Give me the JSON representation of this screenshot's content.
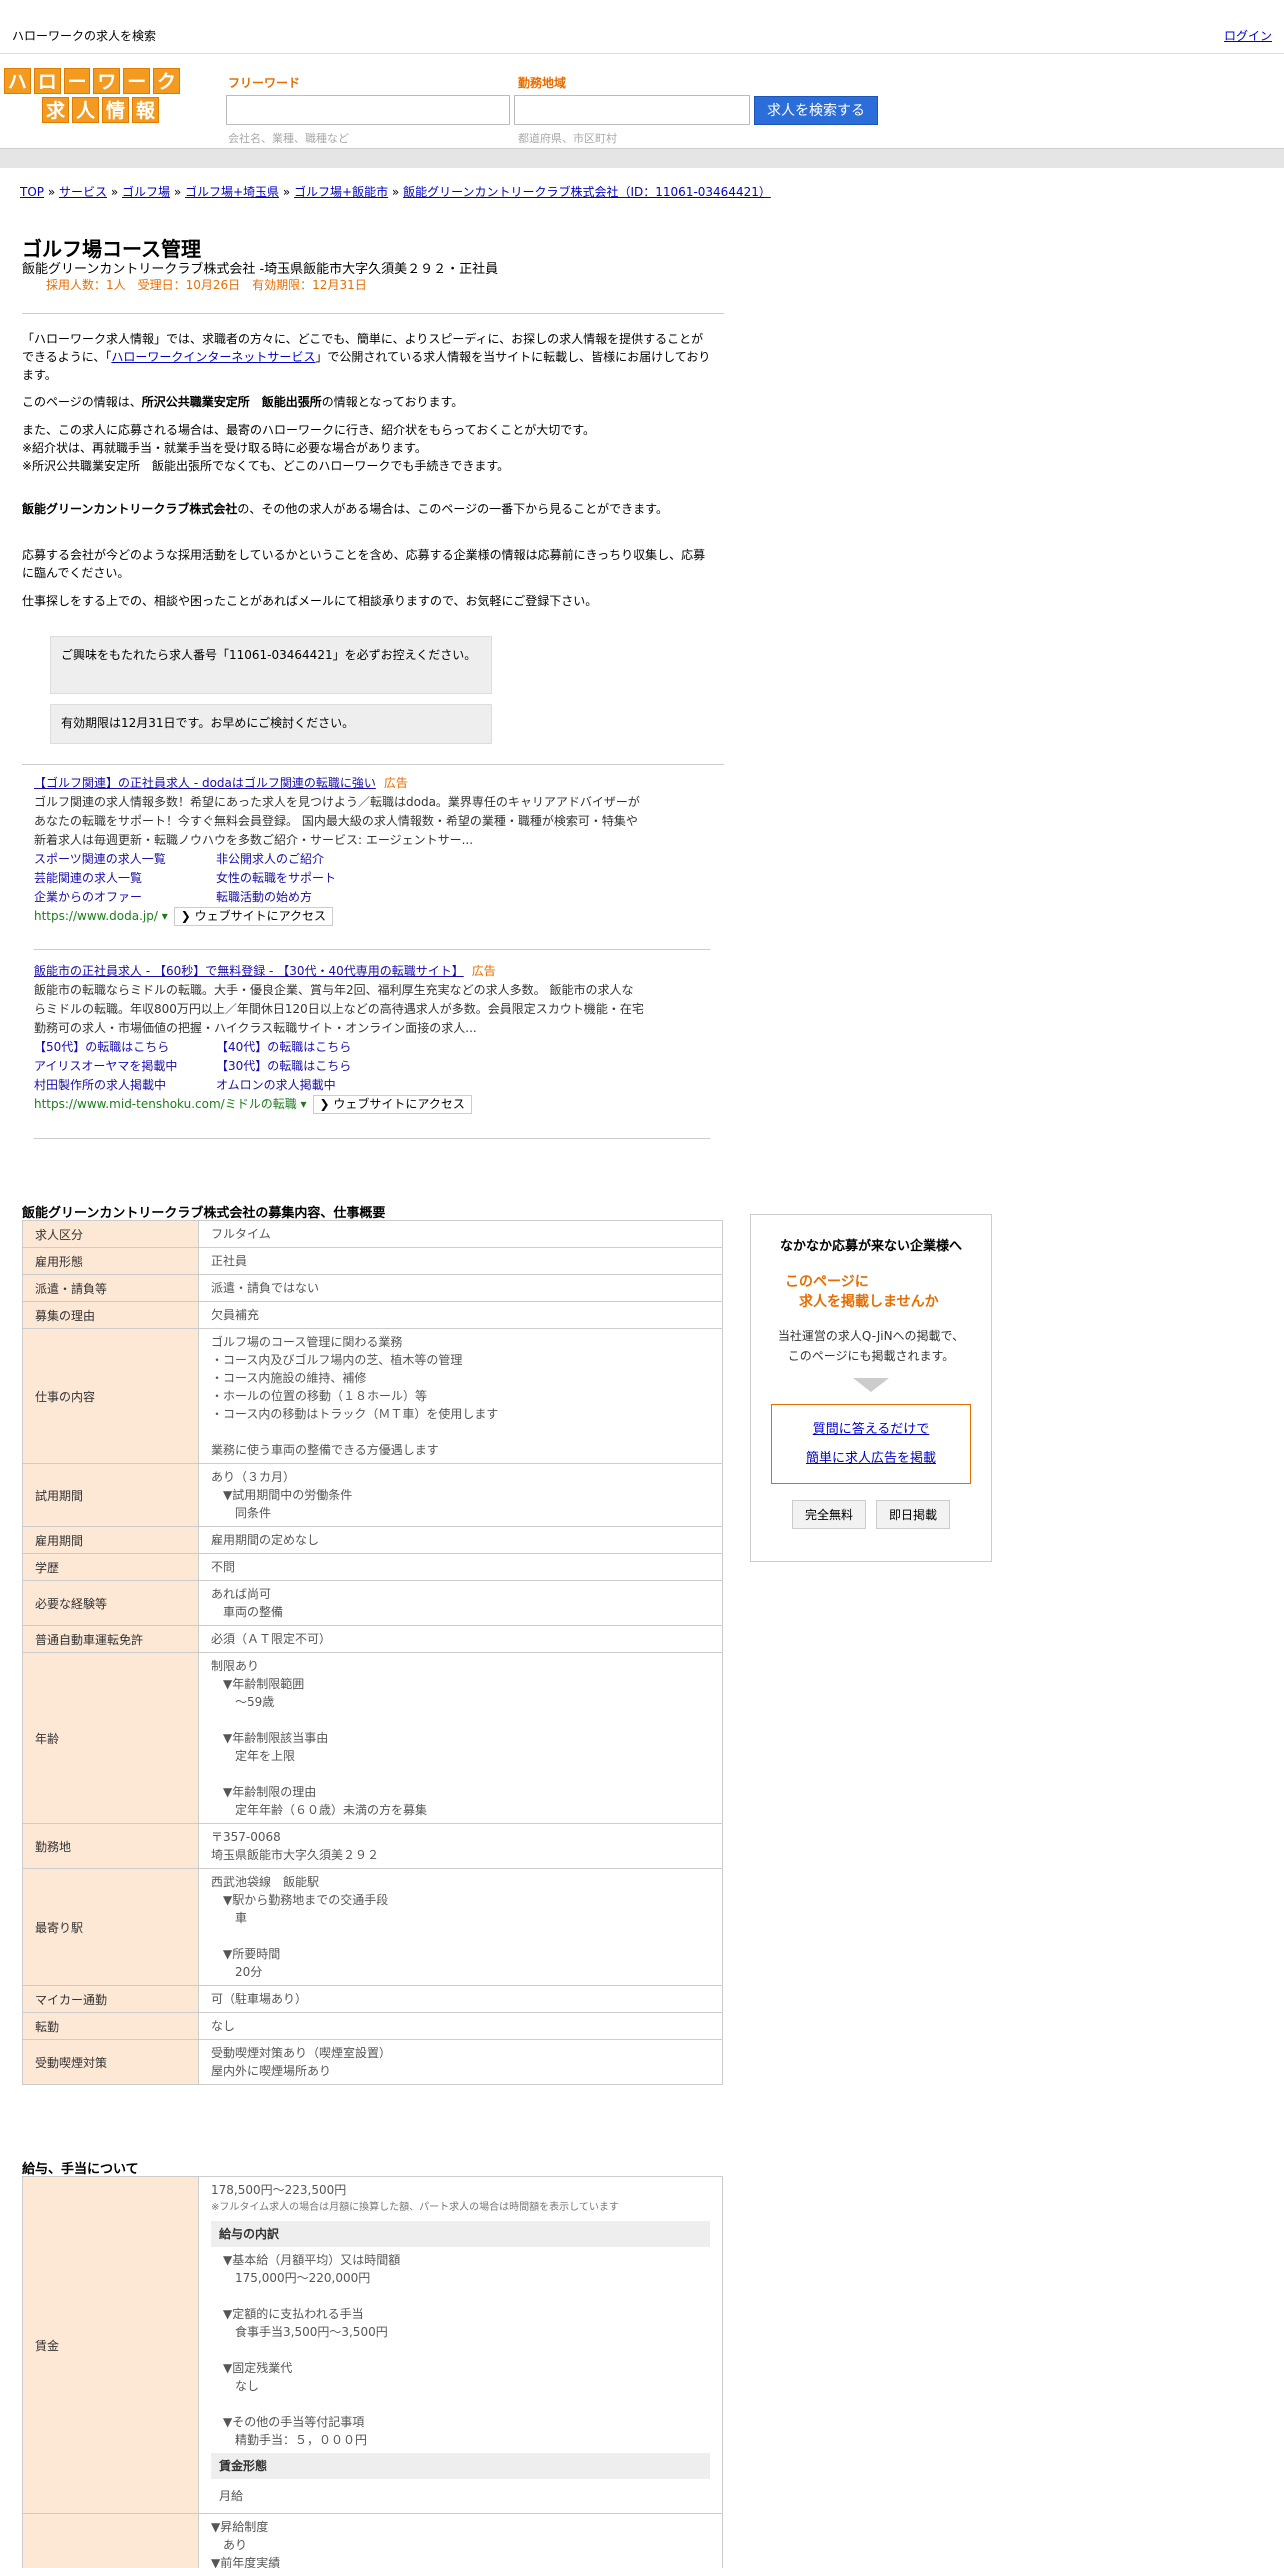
{
  "topbar": {
    "title": "ハローワークの求人を検索",
    "login": "ログイン"
  },
  "logo": {
    "row1": [
      "ハ",
      "ロ",
      "ー",
      "ワ",
      "ー",
      "ク"
    ],
    "row2": [
      "求",
      "人",
      "情",
      "報"
    ]
  },
  "search": {
    "free_label": "フリーワード",
    "free_placeholder": "会社名、業種、職種など",
    "area_label": "勤務地域",
    "area_placeholder": "都道府県、市区町村",
    "button": "求人を検索する"
  },
  "breadcrumb": [
    "TOP",
    "サービス",
    "ゴルフ場",
    "ゴルフ場+埼玉県",
    "ゴルフ場+飯能市",
    "飯能グリーンカントリークラブ株式会社（ID：11061-03464421）"
  ],
  "job": {
    "title": "ゴルフ場コース管理",
    "subtitle": "飯能グリーンカントリークラブ株式会社 -埼玉県飯能市大字久須美２９２・正社員",
    "meta": "採用人数：1人　受理日：10月26日　有効期限：12月31日"
  },
  "intro": {
    "p1a": "「ハローワーク求人情報」では、求職者の方々に、どこでも、簡単に、よりスピーディに、お探しの求人情報を提供することができるように、「",
    "p1link": "ハローワークインターネットサービス",
    "p1b": "」で公開されている求人情報を当サイトに転載し、皆様にお届けしております。",
    "p2a": "このページの情報は、",
    "p2b": "所沢公共職業安定所　飯能出張所",
    "p2c": "の情報となっております。",
    "p3": [
      "また、この求人に応募される場合は、最寄のハローワークに行き、紹介状をもらっておくことが大切です。",
      "※紹介状は、再就職手当・就業手当を受け取る時に必要な場合があります。",
      "※所沢公共職業安定所　飯能出張所でなくても、どこのハローワークでも手続きできます。"
    ],
    "p4a": "飯能グリーンカントリークラブ株式会社",
    "p4b": "の、その他の求人がある場合は、このページの一番下から見ることができます。",
    "p5": "応募する会社が今どのような採用活動をしているかということを含め、応募する企業様の情報は応募前にきっちり収集し、応募に臨んでください。",
    "p6": "仕事探しをする上での、相談や困ったことがあればメールにて相談承りますので、お気軽にご登録下さい。"
  },
  "notices": [
    "ご興味をもたれたら求人番号「11061-03464421」を必ずお控えください。",
    "有効期限は12月31日です。お早めにご検討ください。"
  ],
  "ads": [
    {
      "title": "【ゴルフ関連】の正社員求人 - dodaはゴルフ関連の転職に強い",
      "tag": "広告",
      "desc": "ゴルフ関連の求人情報多数！希望にあった求人を見つけよう／転職はdoda。業界専任のキャリアアドバイザーがあなたの転職をサポート！今すぐ無料会員登録。 国内最大級の求人情報数・希望の業種・職種が検索可・特集や新着求人は毎週更新・転職ノウハウを多数ご紹介・サービス: エージェントサー...",
      "links": [
        "スポーツ関連の求人一覧",
        "非公開求人のご紹介",
        "芸能関連の求人一覧",
        "女性の転職をサポート",
        "企業からのオファー",
        "転職活動の始め方"
      ],
      "url": "https://www.doda.jp/",
      "visit": "ウェブサイトにアクセス"
    },
    {
      "title": "飯能市の正社員求人 - 【60秒】で無料登録 - 【30代・40代専用の転職サイト】",
      "tag": "広告",
      "desc": "飯能市の転職ならミドルの転職。大手・優良企業、賞与年2回、福利厚生充実などの求人多数。 飯能市の求人ならミドルの転職。年収800万円以上／年間休日120日以上などの高待遇求人が多数。会員限定スカウト機能・在宅勤務可の求人・市場価値の把握・ハイクラス転職サイト・オンライン面接の求人...",
      "links": [
        "【50代】の転職はこちら",
        "【40代】の転職はこちら",
        "アイリスオーヤマを掲載中",
        "【30代】の転職はこちら",
        "村田製作所の求人掲載中",
        "オムロンの求人掲載中"
      ],
      "url": "https://www.mid-tenshoku.com/ミドルの転職",
      "visit": "ウェブサイトにアクセス"
    }
  ],
  "section1_title": "飯能グリーンカントリークラブ株式会社の募集内容、仕事概要",
  "details": [
    {
      "k": "求人区分",
      "v": [
        "フルタイム"
      ]
    },
    {
      "k": "雇用形態",
      "v": [
        "正社員"
      ]
    },
    {
      "k": "派遣・請負等",
      "v": [
        "派遣・請負ではない"
      ]
    },
    {
      "k": "募集の理由",
      "v": [
        "欠員補充"
      ]
    },
    {
      "k": "仕事の内容",
      "v": [
        "ゴルフ場のコース管理に関わる業務",
        "・コース内及びゴルフ場内の芝、植木等の管理",
        "・コース内施設の維持、補修",
        "・ホールの位置の移動（１８ホール）等",
        "・コース内の移動はトラック（ＭＴ車）を使用します",
        "",
        "業務に使う車両の整備できる方優遇します"
      ]
    },
    {
      "k": "試用期間",
      "v": [
        "あり（３カ月）",
        "　▼試用期間中の労働条件",
        "　　同条件"
      ]
    },
    {
      "k": "雇用期間",
      "v": [
        "雇用期間の定めなし"
      ]
    },
    {
      "k": "学歴",
      "v": [
        "不問"
      ]
    },
    {
      "k": "必要な経験等",
      "v": [
        "あれば尚可",
        "　車両の整備"
      ]
    },
    {
      "k": "普通自動車運転免許",
      "v": [
        "必須（ＡＴ限定不可）"
      ]
    },
    {
      "k": "年齢",
      "v": [
        "制限あり",
        "　▼年齢制限範囲",
        "　　〜59歳",
        "",
        "　▼年齢制限該当事由",
        "　　定年を上限",
        "",
        "　▼年齢制限の理由",
        "　　定年年齢（６０歳）未満の方を募集"
      ]
    },
    {
      "k": "勤務地",
      "v": [
        "〒357-0068",
        "埼玉県飯能市大字久須美２９２"
      ]
    },
    {
      "k": "最寄り駅",
      "v": [
        "西武池袋線　飯能駅",
        "　▼駅から勤務地までの交通手段",
        "　　車",
        "",
        "　▼所要時間",
        "　　20分"
      ]
    },
    {
      "k": "マイカー通勤",
      "v": [
        "可（駐車場あり）"
      ]
    },
    {
      "k": "転勤",
      "v": [
        "なし"
      ]
    },
    {
      "k": "受動喫煙対策",
      "v": [
        "受動喫煙対策あり（喫煙室設置）",
        "屋内外に喫煙場所あり"
      ]
    }
  ],
  "section2_title": "給与、手当について",
  "salary": {
    "label": "賃金",
    "amount": "178,500円〜223,500円",
    "note": "※フルタイム求人の場合は月額に換算した額、パート求人の場合は時間額を表示しています",
    "breakdown_title": "給与の内訳",
    "breakdown": [
      "▼基本給（月額平均）又は時間額",
      "　175,000円〜220,000円",
      "",
      "▼定額的に支払われる手当",
      "　食事手当3,500円〜3,500円",
      "",
      "▼固定残業代",
      "　なし",
      "",
      "▼その他の手当等付記事項",
      "　精勤手当：５，０００円"
    ],
    "form_title": "賃金形態",
    "form": "月給"
  },
  "raise": {
    "line1": "▼昇給制度",
    "line2": "あり",
    "line3": "▼前年度実績"
  },
  "side": {
    "heading": "なかなか応募が来ない企業様へ",
    "offer1": "このページに",
    "offer2": "求人を掲載しませんか",
    "desc1": "当社運営の求人Q-JiNへの掲載で、",
    "desc2": "このページにも掲載されます。",
    "link1": "質問に答えるだけで",
    "link2": "簡単に求人広告を掲載",
    "btn1": "完全無料",
    "btn2": "即日掲載"
  }
}
